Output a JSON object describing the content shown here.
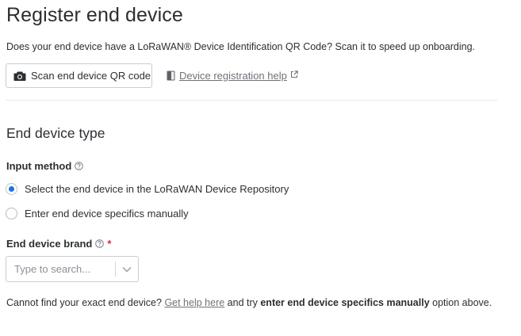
{
  "page": {
    "title": "Register end device",
    "subtitle": "Does your end device have a LoRaWAN® Device Identification QR Code? Scan it to speed up onboarding."
  },
  "actions": {
    "scan_label": "Scan end device QR code",
    "help_link": "Device registration help"
  },
  "section": {
    "title": "End device type"
  },
  "input_method": {
    "label": "Input method",
    "options": [
      {
        "label": "Select the end device in the LoRaWAN Device Repository",
        "checked": true
      },
      {
        "label": "Enter end device specifics manually",
        "checked": false
      }
    ]
  },
  "brand": {
    "label": "End device brand",
    "required_mark": "*",
    "placeholder": "Type to search..."
  },
  "footer": {
    "prefix": "Cannot find your exact end device? ",
    "link": "Get help here",
    "middle": " and try ",
    "bold": "enter end device specifics manually",
    "suffix": " option above."
  },
  "colors": {
    "accent": "#1a73e8",
    "required": "#d7263d",
    "link": "#6e7379"
  },
  "icons": {
    "scan": "camera-icon",
    "help": "book-icon",
    "external": "external-link-icon",
    "info": "question-circle-icon",
    "dropdown": "chevron-down-icon"
  }
}
